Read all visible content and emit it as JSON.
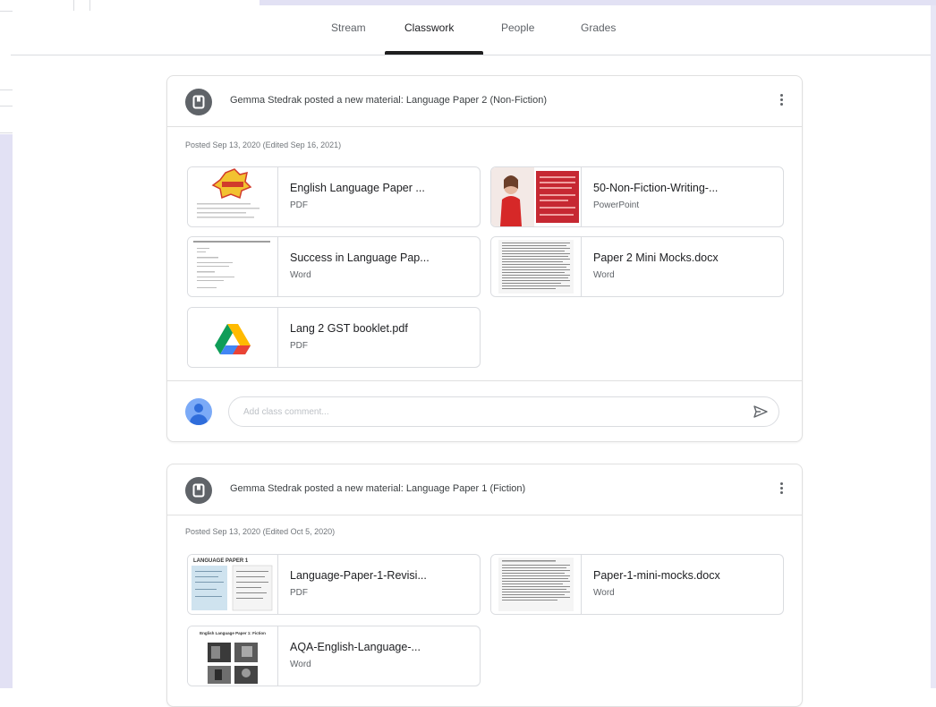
{
  "tabs": [
    {
      "label": "Stream"
    },
    {
      "label": "Classwork"
    },
    {
      "label": "People"
    },
    {
      "label": "Grades"
    }
  ],
  "active_tab": "Classwork",
  "posts": [
    {
      "title": "Gemma Stedrak posted a new material: Language Paper 2 (Non-Fiction)",
      "posted": "Posted Sep 13, 2020 (Edited Sep 16, 2021)",
      "attachments": [
        {
          "name": "English Language Paper ...",
          "type": "PDF",
          "thumb": "pdf-cover-thumbnail"
        },
        {
          "name": "50-Non-Fiction-Writing-...",
          "type": "PowerPoint",
          "thumb": "slide-thumbnail"
        },
        {
          "name": "Success in Language Pap...",
          "type": "Word",
          "thumb": "doc-thumbnail"
        },
        {
          "name": "Paper 2 Mini Mocks.docx",
          "type": "Word",
          "thumb": "dense-text-thumbnail"
        },
        {
          "name": "Lang 2 GST booklet.pdf",
          "type": "PDF",
          "thumb": "google-drive-icon"
        }
      ],
      "comment_placeholder": "Add class comment..."
    },
    {
      "title": "Gemma Stedrak posted a new material: Language Paper 1 (Fiction)",
      "posted": "Posted Sep 13, 2020 (Edited Oct 5, 2020)",
      "attachments": [
        {
          "name": "Language-Paper-1-Revisi...",
          "type": "PDF",
          "thumb": "revision-thumbnail",
          "thumb_text": "LANGUAGE PAPER 1"
        },
        {
          "name": "Paper-1-mini-mocks.docx",
          "type": "Word",
          "thumb": "dense-text-thumbnail"
        },
        {
          "name": "AQA-English-Language-...",
          "type": "Word",
          "thumb": "photo-collage-thumbnail",
          "thumb_text": "English Language Paper 1: Fiction"
        }
      ]
    }
  ],
  "colors": {
    "accent_underline": "#1f1f1f",
    "lavender_frame": "#e2e1f4",
    "avatar_blue": "#7baaf7"
  }
}
